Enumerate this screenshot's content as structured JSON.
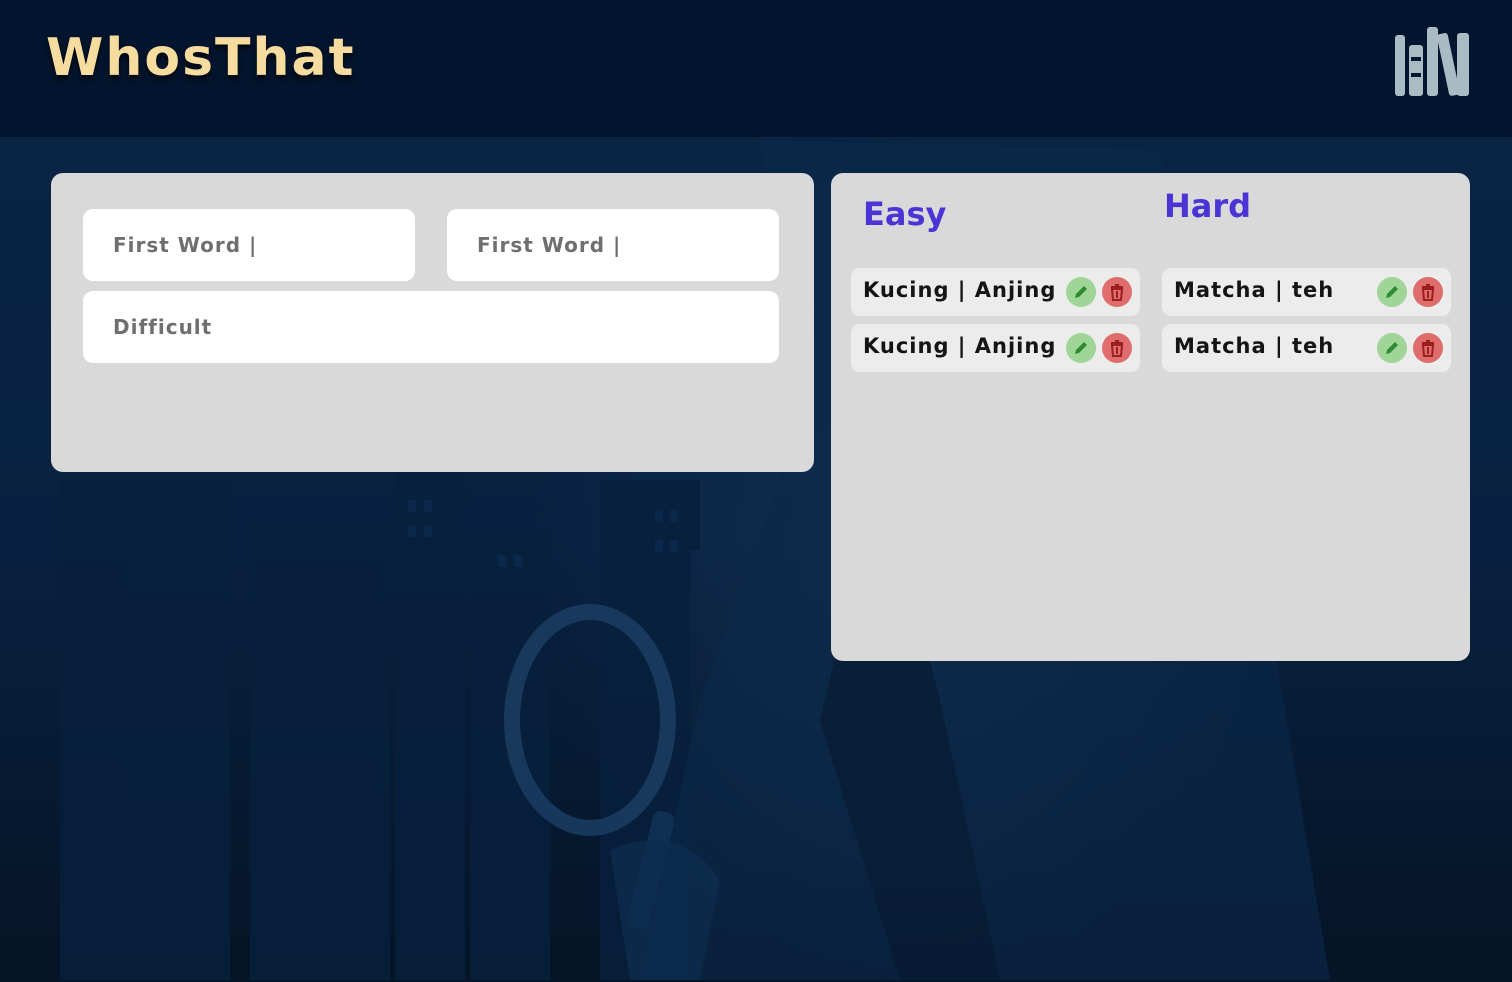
{
  "app": {
    "title": "WhosThat"
  },
  "header": {
    "library_icon": "bookshelf-icon"
  },
  "form": {
    "first_word_placeholder": "First Word |",
    "second_word_placeholder": "First Word |",
    "difficulty_placeholder": "Difficult"
  },
  "lists": {
    "easy": {
      "title": "Easy",
      "items": [
        {
          "text": "Kucing | Anjing"
        },
        {
          "text": "Kucing | Anjing"
        }
      ]
    },
    "hard": {
      "title": "Hard",
      "items": [
        {
          "text": "Matcha | teh"
        },
        {
          "text": "Matcha | teh"
        }
      ]
    }
  },
  "icons": {
    "edit": "pencil-icon",
    "delete": "trash-icon"
  },
  "colors": {
    "header_bg": "#03152e",
    "page_bg": "#082140",
    "panel_bg": "#d9d9d9",
    "logo": "#f6dc9e",
    "column_title": "#4a34d6",
    "edit_button": "#9fd596",
    "delete_button": "#df6d6d"
  }
}
